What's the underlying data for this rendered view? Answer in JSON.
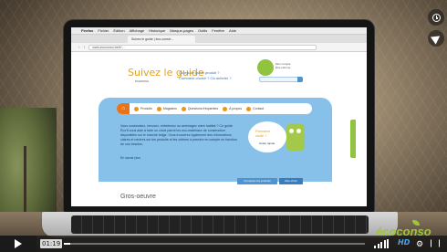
{
  "browser": {
    "menu_items": [
      "Firefox",
      "Fichier",
      "Édition",
      "Affichage",
      "Historique",
      "Marque-pages",
      "Outils",
      "Fenêtre",
      "Aide"
    ],
    "status_right": "",
    "tab_label": "Suivez le guide | éco-constr…",
    "url": "www.ecoconso.be/fr/..."
  },
  "site": {
    "logo": "Suivez le guide",
    "logo_sub": "écoconso",
    "tagline_1": "Qu'est-ce qu'un produit ?",
    "tagline_2": "Comment choisir ? Où acheter ?",
    "login_line1": "Mon compte",
    "login_line2": "Être informé",
    "nav_home_icon": "home-icon",
    "nav_items": [
      "Produits",
      "Magasins",
      "Questions fréquentes",
      "À propos",
      "Contact"
    ],
    "intro_html_plain": "Vous construisez, rénovez, entretenez ou aménagez votre habitat ? Ce guide Éco'ti vous aide à faire un choix parmi les eco-matériaux de construction disponibles sur le marché belge. Vous trouverez également des informations claires et neutres sur les produits et les critères à prendre en compte en fonction de vos besoins.",
    "intro_link": "En savoir plus",
    "bubble_title_1": "Première",
    "bubble_title_2": "visite ?",
    "bubble_sub": "Guide rapide",
    "side_tab": "Donnez votre avis",
    "btn_compare": "Comparer les produits",
    "btn_mur": "Mes choix",
    "section_title": "Gros-oeuvre"
  },
  "player": {
    "time": "01:19",
    "progress": 0.02,
    "brand": "écoconso",
    "hd_label": "HD",
    "clock_icon": "clock-icon",
    "send_icon": "send-icon",
    "settings_icon": "gear-icon",
    "fullscreen_icon": "fullscreen-icon"
  }
}
